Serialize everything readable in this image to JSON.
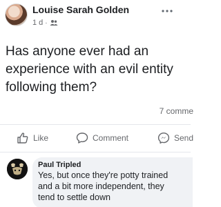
{
  "post": {
    "author": "Louise Sarah Golden",
    "time": "1 d",
    "separator": "·",
    "audience_icon": "friends-icon",
    "more_icon": "more-options-icon",
    "text": "Has anyone ever had an experience with an evil entity following them?",
    "comment_count": "7 comme"
  },
  "actions": {
    "like_label": "Like",
    "comment_label": "Comment",
    "send_label": "Send"
  },
  "comment": {
    "author": "Paul Tripled",
    "lines": [
      "Yes, but once they're potty trained",
      "and a bit more independent, they",
      "tend to settle down"
    ]
  },
  "colors": {
    "text_primary": "#1c1e21",
    "text_secondary": "#65676b",
    "bubble_bg": "#f0f2f5",
    "divider": "#e4e6eb"
  }
}
